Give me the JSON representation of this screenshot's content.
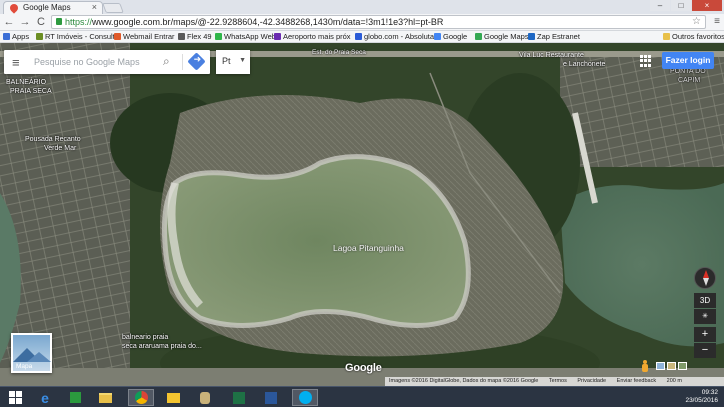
{
  "browser": {
    "tab_title": "Google Maps",
    "tab_close": "×",
    "window_buttons": [
      "–",
      "□",
      "×"
    ],
    "url_prefix": "https://",
    "url_host": "www.google.com.br",
    "url_path": "/maps/@-22.9288604,-42.3488268,1430m/data=!3m1!1e3?hl=pt-BR",
    "nav": {
      "back": "←",
      "forward": "→",
      "reload": "C"
    },
    "bookmarks": [
      {
        "label": "Apps",
        "color": "#3b6ed6"
      },
      {
        "label": "RT Imóveis - Consulto",
        "color": "#6b8e23"
      },
      {
        "label": "Webmail Entrar",
        "color": "#e05a2a"
      },
      {
        "label": "Flex 49",
        "color": "#5a5a5a"
      },
      {
        "label": "WhatsApp Web",
        "color": "#2fb64a"
      },
      {
        "label": "Aeroporto mais próx",
        "color": "#6a2bb0"
      },
      {
        "label": "globo.com - Absoluta",
        "color": "#2a5bd7"
      },
      {
        "label": "Google",
        "color": "#4285f4"
      },
      {
        "label": "Google Maps",
        "color": "#34a853"
      },
      {
        "label": "Zap Estranet",
        "color": "#1d67c4"
      }
    ],
    "other_favorites": "Outros favoritos"
  },
  "map": {
    "search_placeholder": "Pesquise no Google Maps",
    "language": "Pt",
    "login_label": "Fazer login",
    "labels": [
      {
        "text": "BALNEÁRIO",
        "name": "label-balneario"
      },
      {
        "text": "PRAIA SECA",
        "name": "label-praia-seca"
      },
      {
        "text": "Pousada Recanto",
        "name": "label-pousada"
      },
      {
        "text": "Verde Mar",
        "name": "label-verde-mar"
      },
      {
        "text": "Est. do Praia Seca",
        "name": "label-estrada"
      },
      {
        "text": "Vila Luc Restaurante",
        "name": "label-restaurante"
      },
      {
        "text": "e Lanchonete",
        "name": "label-lanchonete"
      },
      {
        "text": "PONTA DO",
        "name": "label-ponta-do"
      },
      {
        "text": "CAPIM",
        "name": "label-capim"
      },
      {
        "text": "balneario praia",
        "name": "label-balneario-praia"
      },
      {
        "text": "seca araruama praia do...",
        "name": "label-seca-araruama"
      }
    ],
    "lagoa_label": "Lagoa Pitanguinha",
    "layers_label": "Mapa",
    "google_logo": "Google",
    "controls": {
      "tilt": "3D",
      "zoom_in": "+",
      "zoom_out": "−"
    },
    "attribution": [
      "Imagens ©2016 DigitalGlobe, Dados do mapa ©2016 Google",
      "Termos",
      "Privacidade",
      "Enviar feedback",
      "200 m"
    ]
  },
  "taskbar": {
    "time": "09:32",
    "date": "23/05/2016"
  }
}
